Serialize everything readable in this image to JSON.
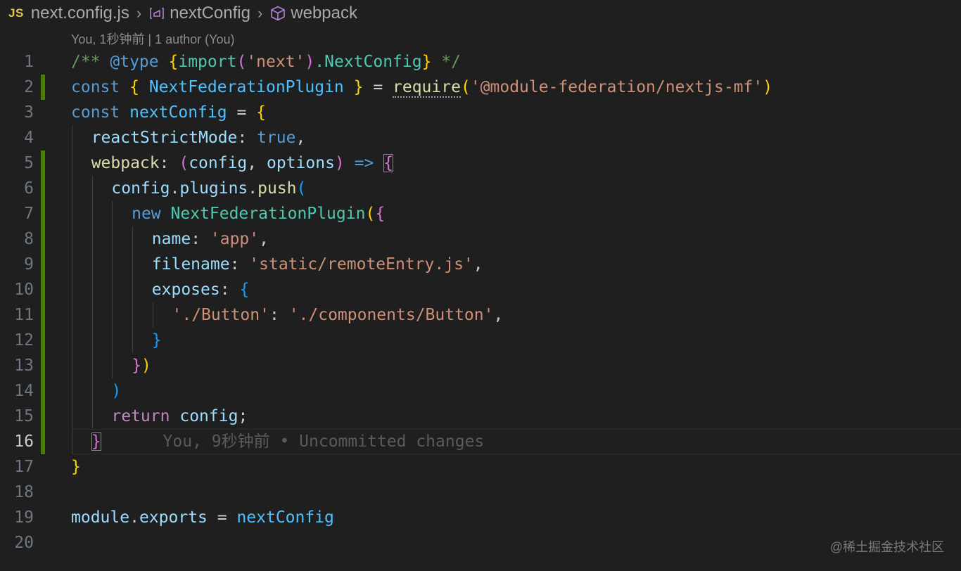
{
  "breadcrumb": {
    "file_icon": "JS",
    "file": "next.config.js",
    "symbol": "nextConfig",
    "member": "webpack",
    "symbol_icon": "variable-icon",
    "member_icon": "cube-icon"
  },
  "blame_header": "You, 1秒钟前 | 1 author (You)",
  "inline_blame": "You, 9秒钟前 • Uncommitted changes",
  "watermark": "@稀土掘金技术社区",
  "colors": {
    "background": "#1f1f1f",
    "modified_gutter": "#487e02",
    "keyword": "#569cd6",
    "string": "#ce9178",
    "comment": "#6a9955",
    "class": "#4ec9b0",
    "property": "#9cdcfe"
  },
  "lines": [
    {
      "num": "1",
      "mod": false,
      "current": false,
      "indent": 0,
      "tokens": [
        [
          "/** ",
          "c"
        ],
        [
          "@type",
          "d"
        ],
        [
          " ",
          "c"
        ],
        [
          "{",
          "p1"
        ],
        [
          "import",
          "e"
        ],
        [
          "(",
          "p2"
        ],
        [
          "'next'",
          "s"
        ],
        [
          ")",
          "p2"
        ],
        [
          ".NextConfig",
          "e"
        ],
        [
          "}",
          "p1"
        ],
        [
          " */",
          "c"
        ]
      ]
    },
    {
      "num": "2",
      "mod": true,
      "current": false,
      "indent": 0,
      "tokens": [
        [
          "const",
          "k"
        ],
        [
          " ",
          "n"
        ],
        [
          "{",
          "p1"
        ],
        [
          " NextFederationPlugin ",
          "w"
        ],
        [
          "}",
          "p1"
        ],
        [
          " = ",
          "o"
        ],
        [
          "require",
          "f",
          "dots"
        ],
        [
          "(",
          "p1"
        ],
        [
          "'@module-federation/nextjs-mf'",
          "s"
        ],
        [
          ")",
          "p1"
        ]
      ]
    },
    {
      "num": "3",
      "mod": false,
      "current": false,
      "indent": 0,
      "tokens": [
        [
          "const",
          "k"
        ],
        [
          " ",
          "n"
        ],
        [
          "nextConfig",
          "w"
        ],
        [
          " = ",
          "o"
        ],
        [
          "{",
          "p1"
        ]
      ]
    },
    {
      "num": "4",
      "mod": false,
      "current": false,
      "indent": 1,
      "tokens": [
        [
          "reactStrictMode",
          "v"
        ],
        [
          ": ",
          "o"
        ],
        [
          "true",
          "x"
        ],
        [
          ",",
          "o"
        ]
      ]
    },
    {
      "num": "5",
      "mod": true,
      "current": false,
      "indent": 1,
      "tokens": [
        [
          "webpack",
          "f"
        ],
        [
          ": ",
          "o"
        ],
        [
          "(",
          "p2"
        ],
        [
          "config",
          "v"
        ],
        [
          ", ",
          "o"
        ],
        [
          "options",
          "v"
        ],
        [
          ")",
          "p2"
        ],
        [
          " => ",
          "k"
        ],
        [
          "{",
          "p2",
          "box"
        ]
      ]
    },
    {
      "num": "6",
      "mod": true,
      "current": false,
      "indent": 2,
      "tokens": [
        [
          "config",
          "v"
        ],
        [
          ".",
          "o"
        ],
        [
          "plugins",
          "v"
        ],
        [
          ".",
          "o"
        ],
        [
          "push",
          "f"
        ],
        [
          "(",
          "p3"
        ]
      ]
    },
    {
      "num": "7",
      "mod": true,
      "current": false,
      "indent": 3,
      "tokens": [
        [
          "new",
          "k"
        ],
        [
          " ",
          "n"
        ],
        [
          "NextFederationPlugin",
          "e"
        ],
        [
          "(",
          "p1"
        ],
        [
          "{",
          "p2"
        ]
      ]
    },
    {
      "num": "8",
      "mod": true,
      "current": false,
      "indent": 4,
      "tokens": [
        [
          "name",
          "v"
        ],
        [
          ": ",
          "o"
        ],
        [
          "'app'",
          "s"
        ],
        [
          ",",
          "o"
        ]
      ]
    },
    {
      "num": "9",
      "mod": true,
      "current": false,
      "indent": 4,
      "tokens": [
        [
          "filename",
          "v"
        ],
        [
          ": ",
          "o"
        ],
        [
          "'static/remoteEntry.js'",
          "s"
        ],
        [
          ",",
          "o"
        ]
      ]
    },
    {
      "num": "10",
      "mod": true,
      "current": false,
      "indent": 4,
      "tokens": [
        [
          "exposes",
          "v"
        ],
        [
          ": ",
          "o"
        ],
        [
          "{",
          "p3"
        ]
      ]
    },
    {
      "num": "11",
      "mod": true,
      "current": false,
      "indent": 5,
      "tokens": [
        [
          "'./Button'",
          "s"
        ],
        [
          ": ",
          "o"
        ],
        [
          "'./components/Button'",
          "s"
        ],
        [
          ",",
          "o"
        ]
      ]
    },
    {
      "num": "12",
      "mod": true,
      "current": false,
      "indent": 4,
      "tokens": [
        [
          "}",
          "p3"
        ]
      ]
    },
    {
      "num": "13",
      "mod": true,
      "current": false,
      "indent": 3,
      "tokens": [
        [
          "}",
          "p2"
        ],
        [
          ")",
          "p1"
        ]
      ]
    },
    {
      "num": "14",
      "mod": true,
      "current": false,
      "indent": 2,
      "tokens": [
        [
          ")",
          "p3"
        ]
      ]
    },
    {
      "num": "15",
      "mod": true,
      "current": false,
      "indent": 2,
      "tokens": [
        [
          "return",
          "m"
        ],
        [
          " ",
          "n"
        ],
        [
          "config",
          "v"
        ],
        [
          ";",
          "o"
        ]
      ]
    },
    {
      "num": "16",
      "mod": true,
      "current": true,
      "indent": 1,
      "tokens": [
        [
          "}",
          "p2",
          "box"
        ]
      ]
    },
    {
      "num": "17",
      "mod": false,
      "current": false,
      "indent": 0,
      "tokens": [
        [
          "}",
          "p1"
        ]
      ]
    },
    {
      "num": "18",
      "mod": false,
      "current": false,
      "indent": 0,
      "tokens": []
    },
    {
      "num": "19",
      "mod": false,
      "current": false,
      "indent": 0,
      "tokens": [
        [
          "module",
          "v"
        ],
        [
          ".",
          "o"
        ],
        [
          "exports",
          "v"
        ],
        [
          " = ",
          "o"
        ],
        [
          "nextConfig",
          "w"
        ]
      ]
    },
    {
      "num": "20",
      "mod": false,
      "current": false,
      "indent": 0,
      "tokens": []
    }
  ]
}
